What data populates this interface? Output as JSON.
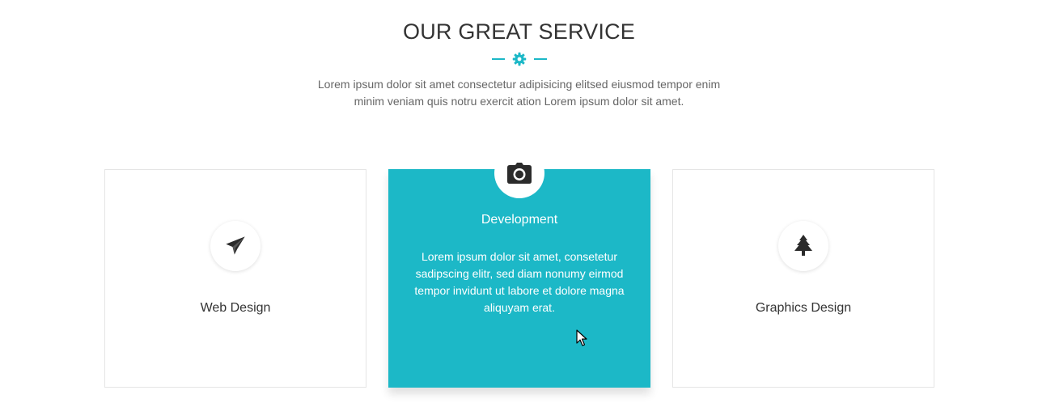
{
  "section": {
    "title": "OUR GREAT SERVICE",
    "subtitle": "Lorem ipsum dolor sit amet consectetur adipisicing elitsed eiusmod tempor enim minim veniam quis notru exercit ation Lorem ipsum dolor sit amet.",
    "divider_icon": "gear-icon"
  },
  "services": [
    {
      "title": "Web Design",
      "icon": "paper-plane-icon"
    },
    {
      "title": "Development",
      "icon": "camera-icon",
      "description": "Lorem ipsum dolor sit amet, consetetur sadipscing elitr, sed diam nonumy eirmod tempor invidunt ut labore et dolore magna aliquyam erat."
    },
    {
      "title": "Graphics Design",
      "icon": "tree-icon"
    }
  ],
  "colors": {
    "accent": "#1cb8c7",
    "heading": "#333333",
    "body_text": "#666666",
    "card_border": "#e5e5e5"
  }
}
